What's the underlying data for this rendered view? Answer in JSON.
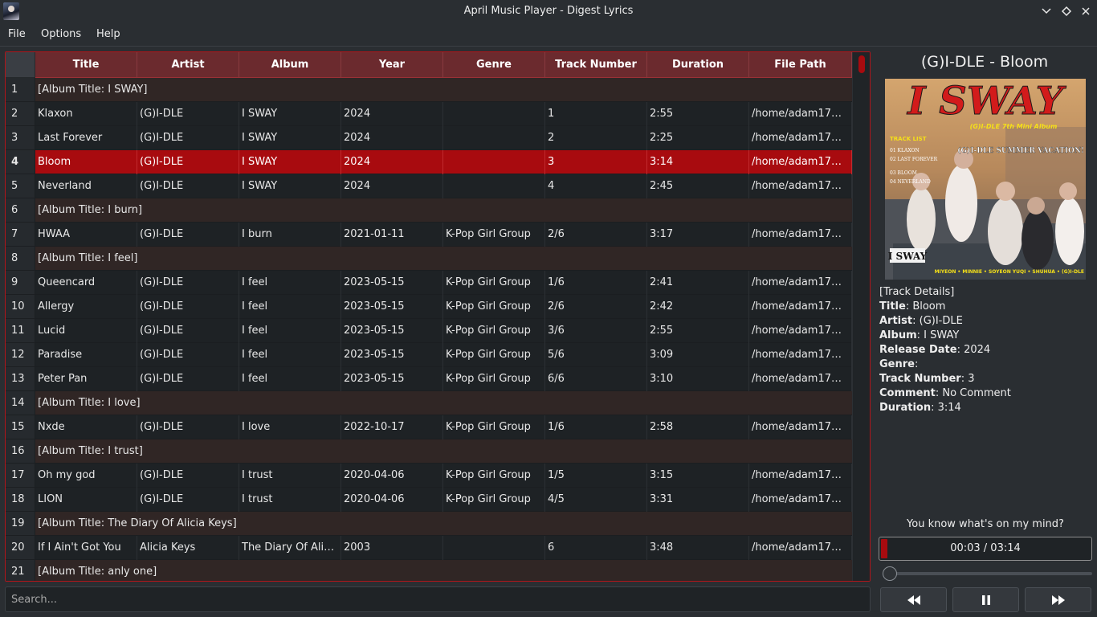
{
  "window": {
    "title": "April Music Player - Digest Lyrics",
    "buttons": [
      "chevron-down-icon",
      "diamond-icon",
      "close-icon"
    ]
  },
  "menu": [
    "File",
    "Options",
    "Help"
  ],
  "table": {
    "columns": [
      "Title",
      "Artist",
      "Album",
      "Year",
      "Genre",
      "Track Number",
      "Duration",
      "File Path"
    ],
    "selected_row": 4,
    "rows": [
      {
        "num": "1",
        "album": "[Album Title: I SWAY]"
      },
      {
        "num": "2",
        "cells": [
          "Klaxon",
          "(G)I-DLE",
          "I SWAY",
          "2024",
          "",
          "1",
          "2:55",
          "/home/adam178/..."
        ]
      },
      {
        "num": "3",
        "cells": [
          "Last Forever",
          "(G)I-DLE",
          "I SWAY",
          "2024",
          "",
          "2",
          "2:25",
          "/home/adam178/..."
        ]
      },
      {
        "num": "4",
        "cells": [
          "Bloom",
          "(G)I-DLE",
          "I SWAY",
          "2024",
          "",
          "3",
          "3:14",
          "/home/adam178/..."
        ],
        "selected": true
      },
      {
        "num": "5",
        "cells": [
          "Neverland",
          "(G)I-DLE",
          "I SWAY",
          "2024",
          "",
          "4",
          "2:45",
          "/home/adam178/..."
        ]
      },
      {
        "num": "6",
        "album": "[Album Title: I burn]"
      },
      {
        "num": "7",
        "cells": [
          "HWAA",
          "(G)I-DLE",
          "I burn",
          "2021-01-11",
          "K-Pop Girl Group",
          "2/6",
          "3:17",
          "/home/adam178/..."
        ]
      },
      {
        "num": "8",
        "album": "[Album Title: I feel]"
      },
      {
        "num": "9",
        "cells": [
          "Queencard",
          "(G)I-DLE",
          "I feel",
          "2023-05-15",
          "K-Pop Girl Group",
          "1/6",
          "2:41",
          "/home/adam178/..."
        ]
      },
      {
        "num": "10",
        "cells": [
          "Allergy",
          "(G)I-DLE",
          "I feel",
          "2023-05-15",
          "K-Pop Girl Group",
          "2/6",
          "2:42",
          "/home/adam178/..."
        ]
      },
      {
        "num": "11",
        "cells": [
          "Lucid",
          "(G)I-DLE",
          "I feel",
          "2023-05-15",
          "K-Pop Girl Group",
          "3/6",
          "2:55",
          "/home/adam178/..."
        ]
      },
      {
        "num": "12",
        "cells": [
          "Paradise",
          "(G)I-DLE",
          "I feel",
          "2023-05-15",
          "K-Pop Girl Group",
          "5/6",
          "3:09",
          "/home/adam178/..."
        ]
      },
      {
        "num": "13",
        "cells": [
          "Peter Pan",
          "(G)I-DLE",
          "I feel",
          "2023-05-15",
          "K-Pop Girl Group",
          "6/6",
          "3:10",
          "/home/adam178/..."
        ]
      },
      {
        "num": "14",
        "album": "[Album Title: I love]"
      },
      {
        "num": "15",
        "cells": [
          "Nxde",
          "(G)I-DLE",
          "I love",
          "2022-10-17",
          "K-Pop Girl Group",
          "1/6",
          "2:58",
          "/home/adam178/..."
        ]
      },
      {
        "num": "16",
        "album": "[Album Title: I trust]"
      },
      {
        "num": "17",
        "cells": [
          "Oh my god",
          "(G)I-DLE",
          "I trust",
          "2020-04-06",
          "K-Pop Girl Group",
          "1/5",
          "3:15",
          "/home/adam178/..."
        ]
      },
      {
        "num": "18",
        "cells": [
          "LION",
          "(G)I-DLE",
          "I trust",
          "2020-04-06",
          "K-Pop Girl Group",
          "4/5",
          "3:31",
          "/home/adam178/..."
        ]
      },
      {
        "num": "19",
        "album": "[Album Title: The Diary Of Alicia Keys]"
      },
      {
        "num": "20",
        "cells": [
          "If I Ain't Got You",
          "Alicia Keys",
          "The Diary Of Alici...",
          "2003",
          "",
          "6",
          "3:48",
          "/home/adam178/..."
        ]
      },
      {
        "num": "21",
        "album": "[Album Title: anly one]"
      }
    ]
  },
  "search": {
    "placeholder": "Search..."
  },
  "now_playing": {
    "title": "(G)I-DLE - Bloom",
    "cover": {
      "headline": "I SWAY",
      "subtitle": "(G)I-DLE 7th Mini Album",
      "tracklist_label": "TRACK LIST",
      "tracks": [
        "01 KLAXON",
        "02 LAST FOREVER",
        "03 BLOOM",
        "04 NEVERLAND"
      ],
      "tagline": "(G)I-DLE SUMMER VACATION!",
      "logo": "I SWAY",
      "members": "MIYEON • MINNIE • SOYEON YUQI • SHUHUA • (G)I-DLE"
    },
    "details_header": "[Track Details]",
    "details": [
      {
        "label": "Title",
        "value": ": Bloom"
      },
      {
        "label": "Artist",
        "value": ": (G)I-DLE"
      },
      {
        "label": "Album",
        "value": ": I SWAY"
      },
      {
        "label": "Release Date",
        "value": ": 2024"
      },
      {
        "label": "Genre",
        "value": ":"
      },
      {
        "label": "Track Number",
        "value": ": 3"
      },
      {
        "label": "Comment",
        "value": ": No Comment"
      },
      {
        "label": "Duration",
        "value": ": 3:14"
      }
    ],
    "lyric": "You know what's on my mind?",
    "progress_text": "00:03 / 03:14",
    "progress_fraction": 0.015,
    "volume_fraction": 0.0
  },
  "controls": {
    "prev": "rewind-icon",
    "pause": "pause-icon",
    "next": "fast-forward-icon"
  },
  "colors": {
    "accent": "#a80b0f",
    "header": "#6b2a2e",
    "album_row": "#302625",
    "background": "#2a2e32"
  }
}
